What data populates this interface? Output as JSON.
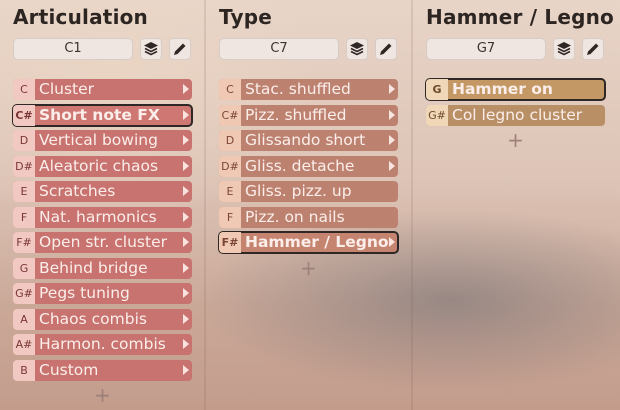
{
  "columns": [
    {
      "title": "Articulation",
      "key_value": "C1",
      "items": [
        {
          "key": "C",
          "label": "Cluster",
          "has_arrow": true,
          "selected": false
        },
        {
          "key": "C#",
          "label": "Short note FX",
          "has_arrow": true,
          "selected": true
        },
        {
          "key": "D",
          "label": "Vertical bowing",
          "has_arrow": true,
          "selected": false
        },
        {
          "key": "D#",
          "label": "Aleatoric chaos",
          "has_arrow": true,
          "selected": false
        },
        {
          "key": "E",
          "label": "Scratches",
          "has_arrow": true,
          "selected": false
        },
        {
          "key": "F",
          "label": "Nat. harmonics",
          "has_arrow": true,
          "selected": false
        },
        {
          "key": "F#",
          "label": "Open str. cluster",
          "has_arrow": true,
          "selected": false
        },
        {
          "key": "G",
          "label": "Behind bridge",
          "has_arrow": true,
          "selected": false
        },
        {
          "key": "G#",
          "label": "Pegs tuning",
          "has_arrow": true,
          "selected": false
        },
        {
          "key": "A",
          "label": "Chaos combis",
          "has_arrow": true,
          "selected": false
        },
        {
          "key": "A#",
          "label": "Harmon. combis",
          "has_arrow": true,
          "selected": false
        },
        {
          "key": "B",
          "label": "Custom",
          "has_arrow": true,
          "selected": false
        }
      ],
      "add_label": "+"
    },
    {
      "title": "Type",
      "key_value": "C7",
      "items": [
        {
          "key": "C",
          "label": "Stac. shuffled",
          "has_arrow": true,
          "selected": false
        },
        {
          "key": "C#",
          "label": "Pizz. shuffled",
          "has_arrow": true,
          "selected": false
        },
        {
          "key": "D",
          "label": "Glissando short",
          "has_arrow": true,
          "selected": false
        },
        {
          "key": "D#",
          "label": "Gliss. detache",
          "has_arrow": true,
          "selected": false
        },
        {
          "key": "E",
          "label": "Gliss. pizz. up",
          "has_arrow": false,
          "selected": false
        },
        {
          "key": "F",
          "label": "Pizz. on nails",
          "has_arrow": false,
          "selected": false
        },
        {
          "key": "F#",
          "label": "Hammer / Legno",
          "has_arrow": true,
          "selected": true
        }
      ],
      "add_label": "+"
    },
    {
      "title": "Hammer / Legno",
      "key_value": "G7",
      "items": [
        {
          "key": "G",
          "label": "Hammer on",
          "has_arrow": false,
          "selected": true
        },
        {
          "key": "G#",
          "label": "Col legno cluster",
          "has_arrow": false,
          "selected": false
        }
      ],
      "add_label": "+"
    }
  ],
  "icons": {
    "layers": "layers-icon",
    "edit": "pencil-icon"
  },
  "colors": {
    "articulation": "#c8736f",
    "type": "#bd8170",
    "hammer": "#b98f66"
  }
}
